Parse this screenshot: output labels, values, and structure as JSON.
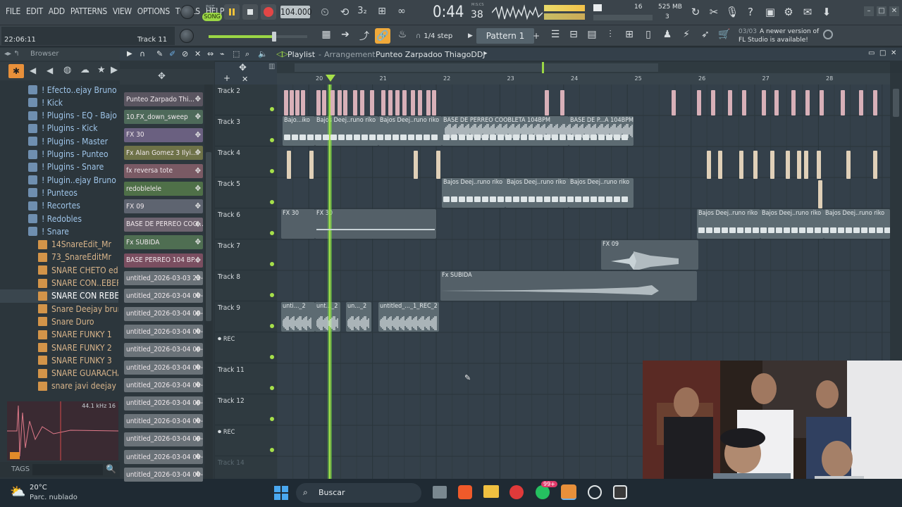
{
  "menu": [
    "FILE",
    "EDIT",
    "ADD",
    "PATTERNS",
    "VIEW",
    "OPTIONS",
    "TOOLS",
    "HELP"
  ],
  "transport": {
    "song_label": "SONG",
    "pat_label": "PAT",
    "tempo": "104.000",
    "time": "0:44",
    "time_frac": "38",
    "time_unit": "M:S:CS",
    "cpu_voices": "16",
    "memory": "525 MB",
    "cpu_num": "3"
  },
  "hint": {
    "time": "22:06:11",
    "track": "Track 11",
    "version_line1": "A newer version of",
    "version_line2": "FL Studio is available!",
    "counter": "03/03"
  },
  "snap": "1/4 step",
  "pattern": "Pattern 1",
  "browser": {
    "title": "Browser",
    "items": [
      {
        "label": "! Efecto..ejay Bruno",
        "type": "folder"
      },
      {
        "label": "! Kick",
        "type": "folder"
      },
      {
        "label": "! Plugins - EQ - Bajo",
        "type": "folder"
      },
      {
        "label": "! Plugins - Kick",
        "type": "folder"
      },
      {
        "label": "! Plugins - Master",
        "type": "folder"
      },
      {
        "label": "! Plugins - Punteo",
        "type": "folder"
      },
      {
        "label": "! Plugins - Snare",
        "type": "folder"
      },
      {
        "label": "! Plugin..ejay Bruno",
        "type": "folder"
      },
      {
        "label": "! Punteos",
        "type": "folder"
      },
      {
        "label": "! Recortes",
        "type": "folder"
      },
      {
        "label": "! Redobles",
        "type": "folder"
      },
      {
        "label": "! Snare",
        "type": "folder"
      },
      {
        "label": "14SnareEdit_Mr",
        "type": "file"
      },
      {
        "label": "73_SnareEditMr",
        "type": "file"
      },
      {
        "label": "SNARE CHETO edit_Mr",
        "type": "file"
      },
      {
        "label": "SNARE CON..EBERB 2.0",
        "type": "file"
      },
      {
        "label": "SNARE CON REBERB",
        "type": "file"
      },
      {
        "label": "Snare Deejay bruno",
        "type": "file"
      },
      {
        "label": "Snare Duro",
        "type": "file"
      },
      {
        "label": "SNARE FUNKY 1",
        "type": "file"
      },
      {
        "label": "SNARE FUNKY 2",
        "type": "file"
      },
      {
        "label": "SNARE FUNKY 3",
        "type": "file"
      },
      {
        "label": "SNARE GUARACHA",
        "type": "file"
      },
      {
        "label": "snare javi deejay",
        "type": "file"
      }
    ],
    "sample_info": "44.1 kHz 16",
    "tags_label": "TAGS"
  },
  "channels": [
    {
      "label": "Punteo Zarpado Thi...",
      "color": "#5a5560"
    },
    {
      "label": "10.FX_down_sweep",
      "color": "#4e6a5a"
    },
    {
      "label": "FX 30",
      "color": "#6a6080"
    },
    {
      "label": "Fx Alan Gomez 3 Ilyi...",
      "color": "#6e7248"
    },
    {
      "label": "fx reversa tote",
      "color": "#7a5a64"
    },
    {
      "label": "redoblelele",
      "color": "#4f7048"
    },
    {
      "label": "FX 09",
      "color": "#5e6470"
    },
    {
      "label": "BASE DE PERREO COO...",
      "color": "#6e6470"
    },
    {
      "label": "Fx SUBIDA",
      "color": "#4f6e52"
    },
    {
      "label": "BASE PERREO 104 BP...",
      "color": "#7a4e60"
    },
    {
      "label": "untitled_2026-03-03 23-...",
      "color": "#6a7278"
    },
    {
      "label": "untitled_2026-03-04 00-...",
      "color": "#6a7278"
    },
    {
      "label": "untitled_2026-03-04 00-...",
      "color": "#6a7278"
    },
    {
      "label": "untitled_2026-03-04 00-...",
      "color": "#6a7278"
    },
    {
      "label": "untitled_2026-03-04 00-...",
      "color": "#6a7278"
    },
    {
      "label": "untitled_2026-03-04 00-...",
      "color": "#6a7278"
    },
    {
      "label": "untitled_2026-03-04 00-...",
      "color": "#6a7278"
    },
    {
      "label": "untitled_2026-03-04 00-...",
      "color": "#6a7278"
    },
    {
      "label": "untitled_2026-03-04 00-...",
      "color": "#6a7278"
    },
    {
      "label": "untitled_2026-03-04 00-...",
      "color": "#6a7278"
    },
    {
      "label": "untitled_2026-03-04 00-...",
      "color": "#6a7278"
    },
    {
      "label": "untitled_2026-03-04 00-...",
      "color": "#6a7278"
    }
  ],
  "playlist": {
    "title": "Playlist",
    "subtitle": "Arrangement",
    "pattern_name": "Punteo Zarpadoo ThiagoDDJ",
    "bars": [
      "20",
      "21",
      "22",
      "23",
      "24",
      "25",
      "26",
      "27",
      "28"
    ],
    "tracks": [
      "Track 2",
      "Track 3",
      "Track 4",
      "Track 5",
      "Track 6",
      "Track 7",
      "Track 8",
      "Track 9",
      "REC",
      "Track 11",
      "Track 12",
      "REC",
      "Track 14"
    ],
    "clips": {
      "t3a": "Bajo...iko",
      "t3b": "Bajos Deej..runo riko",
      "t3c": "Bajos Deej..runo riko",
      "t3d": "BASE DE PERREO COOBLETA 104BPM",
      "t3e": "BASE DE P...A 104BPM",
      "t5a": "Bajos Deej..runo riko",
      "t5b": "Bajos Deej..runo riko",
      "t5c": "Bajos Deej..runo riko",
      "t6a": "FX 30",
      "t6b": "FX 30",
      "t6c": "Bajos Deej..runo riko",
      "t6d": "Bajos Deej..runo riko",
      "t6e": "Bajos Deej..runo riko",
      "t7a": "FX 09",
      "t8a": "Fx SUBIDA",
      "t9a": "unti..._2",
      "t9b": "unt..._2",
      "t9c": "un..._2",
      "t9d": "untitled_..._1_REC_2"
    }
  },
  "taskbar": {
    "temp": "20°C",
    "weather": "Parc. nublado",
    "search": "Buscar",
    "badge": "99+"
  }
}
